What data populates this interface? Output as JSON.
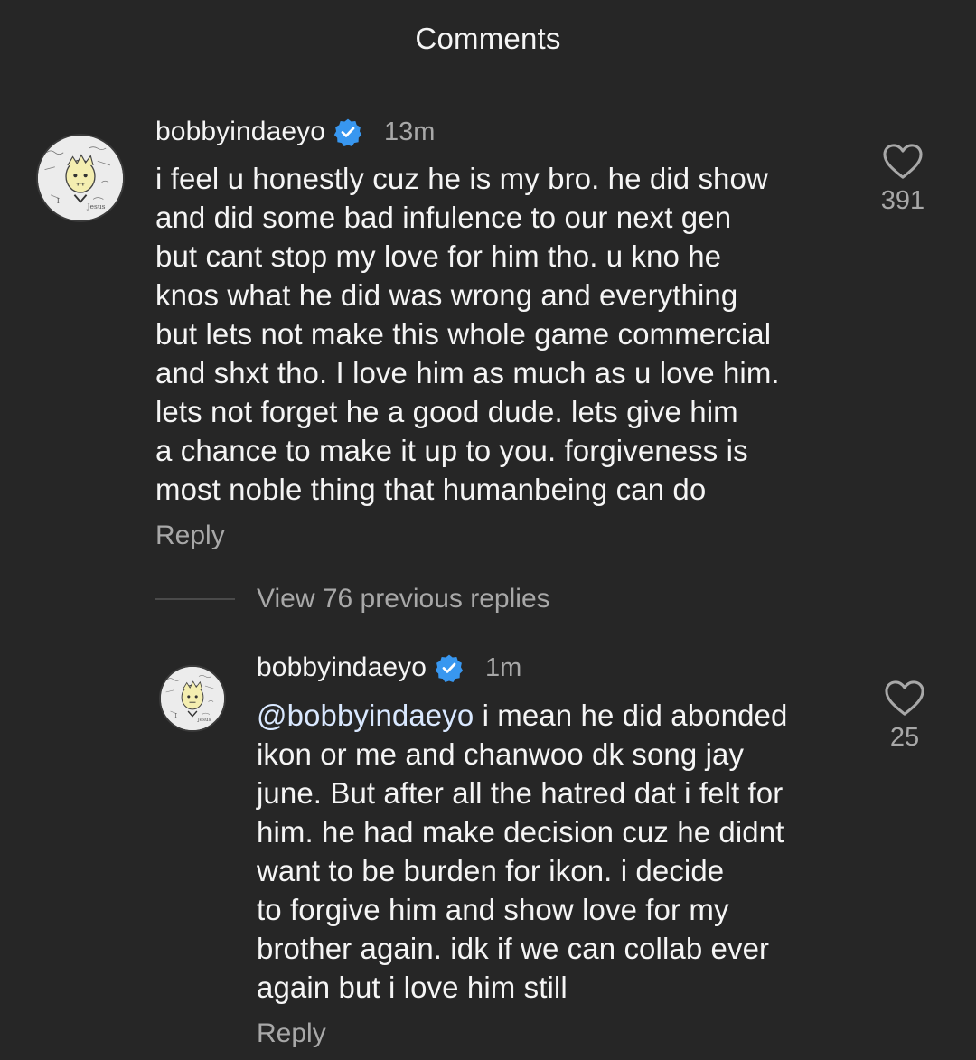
{
  "header": {
    "title": "Comments"
  },
  "comments": [
    {
      "username": "bobbyindaeyo",
      "verified": true,
      "time": "13m",
      "text": "i feel u honestly cuz he is my bro. he did show\nand did some bad infulence to our next gen\nbut cant stop my love for him tho. u kno he\nknos what he did was wrong and everything\nbut lets not make this whole game commercial\nand shxt tho. I love him as much as u love him.\nlets not forget he a good dude. lets give him\na chance to make it up to you. forgiveness is\nmost noble thing that humanbeing can do",
      "reply_label": "Reply",
      "likes": "391"
    }
  ],
  "view_replies": {
    "label": "View 76 previous replies"
  },
  "replies": [
    {
      "username": "bobbyindaeyo",
      "verified": true,
      "time": "1m",
      "mention": "@bobbyindaeyo",
      "text": " i mean he did abonded\nikon or me and chanwoo dk song jay\njune. But after all the hatred dat i felt for\nhim. he had make decision cuz he didnt\nwant to be burden for ikon. i decide\nto forgive him and show love for my\nbrother again. idk if we can collab ever\nagain but i love him still",
      "reply_label": "Reply",
      "likes": "25"
    }
  ],
  "colors": {
    "background": "#262626",
    "primary_text": "#f5f5f5",
    "secondary_text": "#a8a8a8",
    "verified_badge": "#3897f0"
  },
  "icons": {
    "verified": "verified-badge-icon",
    "like": "heart-outline-icon"
  }
}
